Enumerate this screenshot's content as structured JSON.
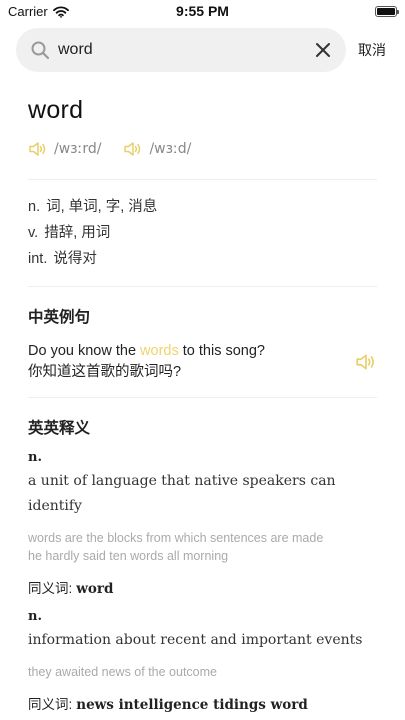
{
  "status_bar": {
    "carrier": "Carrier",
    "time": "9:55 PM"
  },
  "search": {
    "query": "word",
    "cancel_label": "取消"
  },
  "entry": {
    "headword": "word",
    "phonetics": [
      "/wɜːrd/",
      "/wɜːd/"
    ],
    "definitions": [
      {
        "pos": "n.",
        "meaning": "词, 单词, 字, 消息"
      },
      {
        "pos": "v.",
        "meaning": "措辞, 用词"
      },
      {
        "pos": "int.",
        "meaning": "说得对"
      }
    ]
  },
  "example_section": {
    "title": "中英例句",
    "en_before": "Do you know the ",
    "en_highlight": "words",
    "en_after": " to this song?",
    "zh": "你知道这首歌的歌词吗?"
  },
  "en_en_section": {
    "title": "英英释义",
    "synonym_label": "同义词:",
    "senses": [
      {
        "pos": "n.",
        "gloss": "a unit of language that native speakers can identify",
        "examples": [
          "words are the blocks from which sentences are made",
          "he hardly said ten words all morning"
        ],
        "synonyms": "word"
      },
      {
        "pos": "n.",
        "gloss": "information about recent and important events",
        "examples": [
          "they awaited news of the outcome"
        ],
        "synonyms": "news intelligence tidings word"
      }
    ]
  },
  "colors": {
    "highlight": "#f1d36a",
    "speaker": "#e8cf6a",
    "muted": "#aaaaaa"
  }
}
